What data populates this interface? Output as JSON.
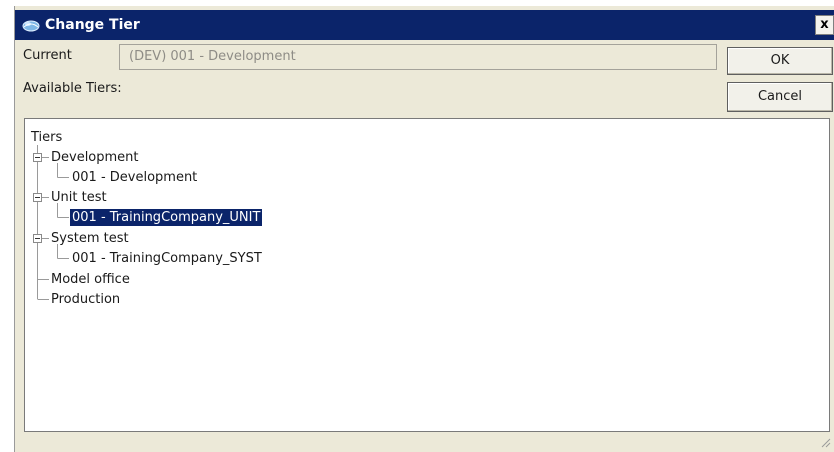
{
  "dialog": {
    "title": "Change Tier",
    "close_glyph": "x",
    "current_label": "Current",
    "current_value": "(DEV) 001 - Development",
    "available_label": "Available Tiers:",
    "ok_label": "OK",
    "cancel_label": "Cancel"
  },
  "tree": {
    "root": "Tiers",
    "nodes": [
      {
        "label": "Development",
        "children": [
          "001 - Development"
        ]
      },
      {
        "label": "Unit test",
        "children": [
          "001 - TrainingCompany_UNIT"
        ]
      },
      {
        "label": "System test",
        "children": [
          "001 - TrainingCompany_SYST"
        ]
      },
      {
        "label": "Model office",
        "children": []
      },
      {
        "label": "Production",
        "children": []
      }
    ],
    "selected": "001 - TrainingCompany_UNIT"
  },
  "colors": {
    "titlebar": "#0b246a",
    "selection": "#0b246a",
    "dialog_bg": "#ece9d8"
  },
  "icons": {
    "title": "tier-globe-icon",
    "expand": "minus-box-icon",
    "close": "close-icon",
    "resize": "resize-grip-icon"
  }
}
